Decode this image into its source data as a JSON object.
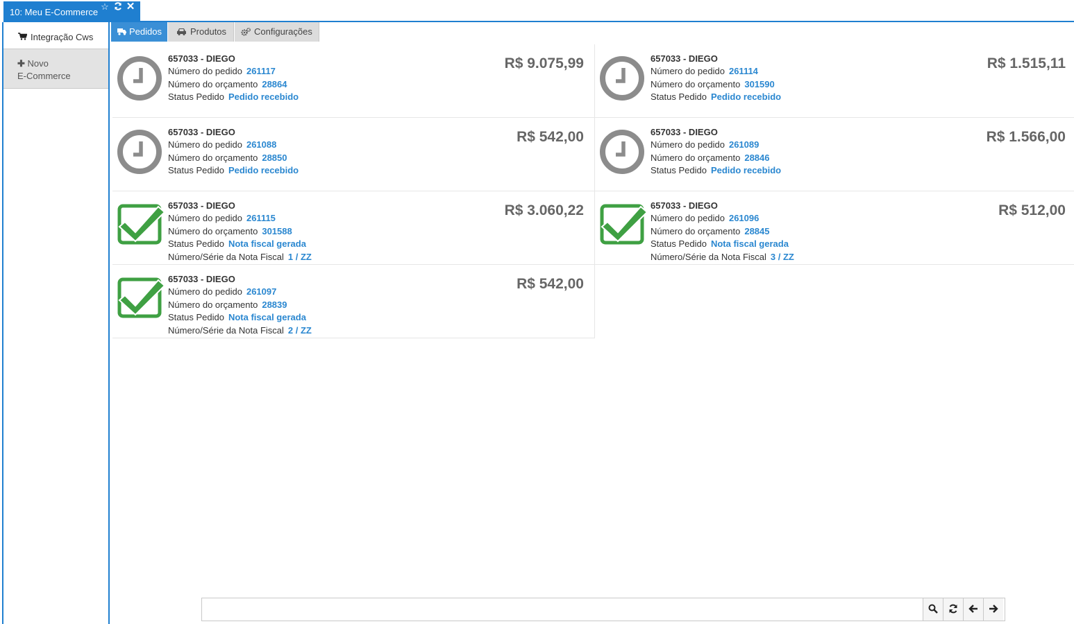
{
  "window_tab": {
    "title": "10: Meu E-Commerce",
    "accent_color": "#1f7fd0",
    "controls": [
      "star-icon",
      "refresh-icon",
      "close-icon"
    ]
  },
  "sidebar": {
    "items": [
      {
        "label": "Integração Cws",
        "icon": "cart-icon",
        "active": true
      },
      {
        "label_line1": "Novo",
        "label_line2": "E-Commerce",
        "icon": "plus-icon",
        "active": false
      }
    ]
  },
  "tabs": [
    {
      "label": "Pedidos",
      "icon": "truck-icon",
      "active": true
    },
    {
      "label": "Produtos",
      "icon": "car-icon",
      "active": false
    },
    {
      "label": "Configurações",
      "icon": "cogs-icon",
      "active": false
    }
  ],
  "labels": {
    "pedido": "Número do pedido",
    "orcamento": "Número do orçamento",
    "status": "Status Pedido",
    "nota": "Número/Série da Nota Fiscal"
  },
  "orders": [
    {
      "customer": "657033 - DIEGO",
      "pedido": "261117",
      "orcamento": "28864",
      "status": "Pedido recebido",
      "status_icon": "clock-icon",
      "nota": null,
      "price": "R$ 9.075,99"
    },
    {
      "customer": "657033 - DIEGO",
      "pedido": "261114",
      "orcamento": "301590",
      "status": "Pedido recebido",
      "status_icon": "clock-icon",
      "nota": null,
      "price": "R$ 1.515,11"
    },
    {
      "customer": "657033 - DIEGO",
      "pedido": "261088",
      "orcamento": "28850",
      "status": "Pedido recebido",
      "status_icon": "clock-icon",
      "nota": null,
      "price": "R$ 542,00"
    },
    {
      "customer": "657033 - DIEGO",
      "pedido": "261089",
      "orcamento": "28846",
      "status": "Pedido recebido",
      "status_icon": "clock-icon",
      "nota": null,
      "price": "R$ 1.566,00"
    },
    {
      "customer": "657033 - DIEGO",
      "pedido": "261115",
      "orcamento": "301588",
      "status": "Nota fiscal gerada",
      "status_icon": "check-icon",
      "nota": "1 / ZZ",
      "price": "R$ 3.060,22"
    },
    {
      "customer": "657033 - DIEGO",
      "pedido": "261096",
      "orcamento": "28845",
      "status": "Nota fiscal gerada",
      "status_icon": "check-icon",
      "nota": "3 / ZZ",
      "price": "R$ 512,00"
    },
    {
      "customer": "657033 - DIEGO",
      "pedido": "261097",
      "orcamento": "28839",
      "status": "Nota fiscal gerada",
      "status_icon": "check-icon",
      "nota": "2 / ZZ",
      "price": "R$ 542,00"
    }
  ],
  "search": {
    "value": "",
    "placeholder": "",
    "buttons": [
      "search-icon",
      "refresh-icon",
      "arrow-left-icon",
      "arrow-right-icon"
    ]
  },
  "colors": {
    "link": "#2a87d0",
    "clock": "#8c8c8c",
    "check": "#3fa043"
  }
}
